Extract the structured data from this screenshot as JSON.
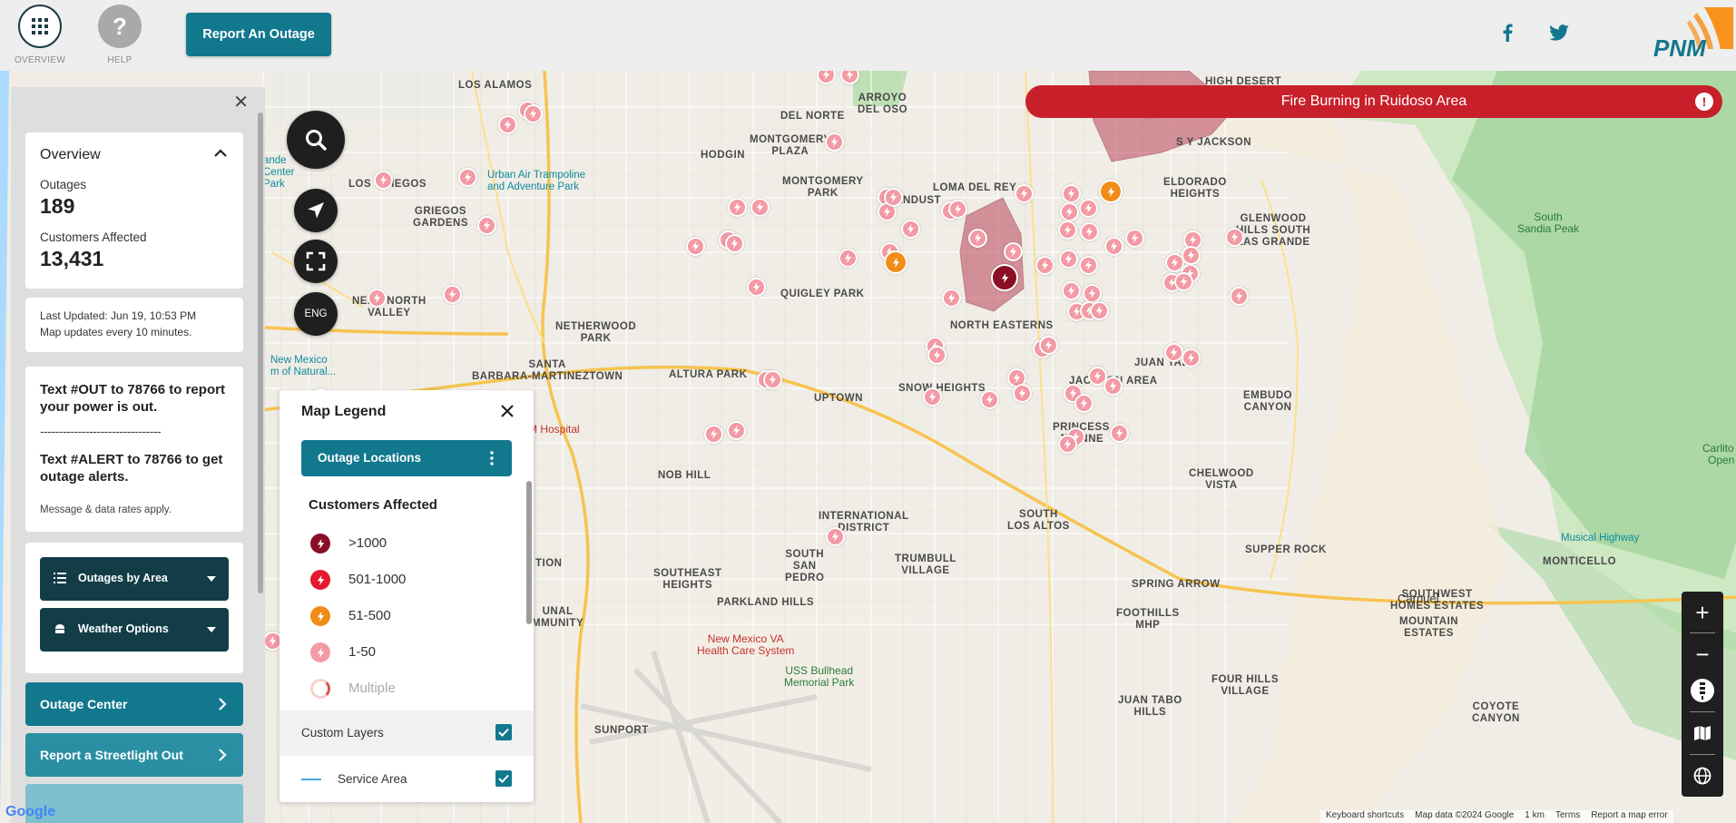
{
  "header": {
    "overview_label": "OVERVIEW",
    "help_label": "HELP",
    "help_glyph": "?",
    "report_button": "Report An Outage",
    "social": [
      "facebook-icon",
      "twitter-icon"
    ],
    "logo_text": "PNM",
    "accent": "#12788e"
  },
  "alert": {
    "text": "Fire Burning in Ruidoso Area",
    "glyph": "!",
    "color": "#c8202a"
  },
  "panel": {
    "overview_title": "Overview",
    "outages_label": "Outages",
    "outages_value": "189",
    "customers_label": "Customers Affected",
    "customers_value": "13,431",
    "updated_line1": "Last Updated:  Jun 19, 10:53 PM",
    "updated_line2": "Map updates every 10 minutes.",
    "text_out": "Text #OUT to 78766 to report your power is out.",
    "dashes": "--------------------------------",
    "text_alert": "Text #ALERT to 78766 to get outage alerts.",
    "rates": "Message & data rates apply.",
    "outages_by_area": "Outages by Area",
    "weather_options": "Weather Options",
    "outage_center": "Outage Center",
    "report_streetlight": "Report a Streetlight Out"
  },
  "map_controls": {
    "language": "ENG",
    "zoom_in": "+",
    "zoom_out": "−"
  },
  "legend": {
    "title": "Map Legend",
    "tab": "Outage Locations",
    "subtitle": "Customers Affected",
    "items": [
      {
        "label": ">1000",
        "color": "#8a0f24"
      },
      {
        "label": "501-1000",
        "color": "#e2192f"
      },
      {
        "label": "51-500",
        "color": "#f08d17"
      },
      {
        "label": "1-50",
        "color": "#f49aa4"
      },
      {
        "label": "Multiple",
        "color": "#f3d3c9"
      }
    ],
    "custom_layers": "Custom Layers",
    "service_area": "Service Area"
  },
  "map_labels": {
    "north_valley": "NEAR NORTH\nVALLEY",
    "los_griegos": "LOS GRIEGOS",
    "griegos_gardens": "GRIEGOS\nGARDENS",
    "los_alamos": "LOS ALAMOS",
    "del_norte": "DEL NORTE",
    "montgomery_plaza": "MONTGOMERY\nPLAZA",
    "hodgin": "HODGIN",
    "montgomery_park": "MONTGOMERY\nPARK",
    "sandust": "SANDUST",
    "loma_del_rey": "LOMA DEL REY",
    "quigley_park": "QUIGLEY PARK",
    "netherwood": "NETHERWOOD\nPARK",
    "santa_barbara": "SANTA\nBARBARA-MARTINEZTOWN",
    "altura_park": "ALTURA PARK",
    "uptown": "UPTOWN",
    "north_eastern": "NORTH EASTERNS",
    "snow_heights": "SNOW HEIGHTS",
    "nob_hill": "NOB HILL",
    "international": "INTERNATIONAL\nDISTRICT",
    "south_san_pedro": "SOUTH\nSAN\nPEDRO",
    "trumbull": "TRUMBULL\nVILLAGE",
    "south_los_altos": "SOUTH\nLOS ALTOS",
    "southeast_heights": "SOUTHEAST\nHEIGHTS",
    "parkland_hills": "PARKLAND HILLS",
    "juan_tabo": "JUAN TABO",
    "jackson_area": "JACKSON AREA",
    "princess_jeanne": "PRINCESS\nJEANNE",
    "embudo": "EMBUDO\nCANYON",
    "chelwood": "CHELWOOD\nVISTA",
    "supper_rock": "SUPPER ROCK",
    "spring_arrow": "SPRING ARROW",
    "foothills": "FOOTHILLS\nMHP",
    "four_hills": "FOUR HILLS\nVILLAGE",
    "juan_tabo_hills": "JUAN TABO\nHILLS",
    "sunport": "SUNPORT",
    "eldorado": "ELDORADO\nHEIGHTS",
    "glenwood": "GLENWOOD\nHILLS SOUTH\nLAS GRANDE",
    "sy_jackson": "S Y JACKSON",
    "high_desert": "HIGH DESERT",
    "arroyo": "ARROYO\nDEL OSO",
    "monticello": "MONTICELLO",
    "southwest_homes": "SOUTHWEST\nHOMES ESTATES",
    "mountain_estates": "MOUNTAIN\nESTATES",
    "coyote": "COYOTE\nCANYON",
    "carnuel": "Carnuel",
    "sandia_peak": "South\nSandia Peak",
    "musical_highway": "Musical Highway",
    "carlito": "Carlito Sp\nOpen S",
    "urban_air": "Urban Air Trampoline\nand Adventure Park",
    "nm_museum": "New Mexico\nm of Natural...",
    "hospital": "M Hospital",
    "va_health": "New Mexico VA\nHealth Care System",
    "uss_bullhead": "USS Bullhead\nMemorial Park",
    "lenda_center": "ande\nCenter\nPark",
    "maunal": "UNAL\nMMUNITY",
    "tion": "TION"
  },
  "footer": {
    "keyboard": "Keyboard shortcuts",
    "map_data": "Map data ©2024 Google",
    "scale": "1 km",
    "terms": "Terms",
    "report": "Report a map error",
    "google": "Google"
  }
}
